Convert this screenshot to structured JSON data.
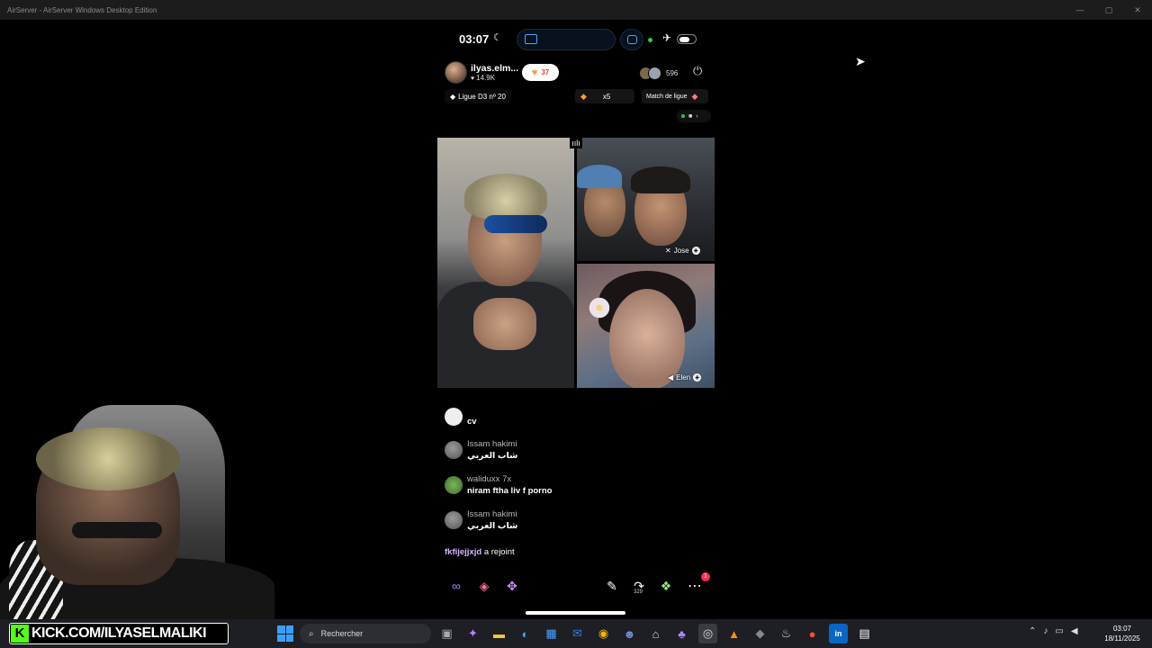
{
  "window": {
    "title": "AirServer - AirServer Windows Desktop Edition"
  },
  "statusbar": {
    "time": "03:07"
  },
  "host": {
    "name": "ilyas.elm...",
    "likes": "14.9K",
    "follow_count": "37"
  },
  "viewers": {
    "count": "596"
  },
  "league": {
    "label": "Ligue D3 nº 20",
    "boost": "x5",
    "match": "Match de ligue"
  },
  "participants": [
    {
      "name": "Jose"
    },
    {
      "name": "Elen"
    }
  ],
  "chat": {
    "messages": [
      {
        "user": "",
        "text": "cv"
      },
      {
        "user": "Issam hakimi",
        "text": "شاب العربي"
      },
      {
        "user": "waliduxx 7x",
        "text": "niram ftha liv f porno"
      },
      {
        "user": "Issam hakimi",
        "text": "شاب العربي"
      }
    ],
    "joined": {
      "user": "fkfijejjxjd",
      "action": "a rejoint"
    }
  },
  "bottombar": {
    "share_count": "329",
    "notif_badge": "1"
  },
  "kick": {
    "logo": "K",
    "url": "KICK.COM/ILYASELMALIKI"
  },
  "taskbar": {
    "search_placeholder": "Rechercher",
    "clock_time": "03:07",
    "clock_date": "18/11/2025",
    "apps": [
      "task-view",
      "copilot",
      "file-explorer",
      "edge",
      "store",
      "outlook",
      "chrome",
      "discord",
      "media",
      "game-controller",
      "obs",
      "vlc",
      "app-dark",
      "steam",
      "app-red",
      "linkedin",
      "epic-games"
    ]
  },
  "colors": {
    "accent": "#4aa3ff",
    "follow_orange": "#ff9a3c",
    "kick_green": "#53fc18",
    "badge_red": "#ff2d55"
  }
}
